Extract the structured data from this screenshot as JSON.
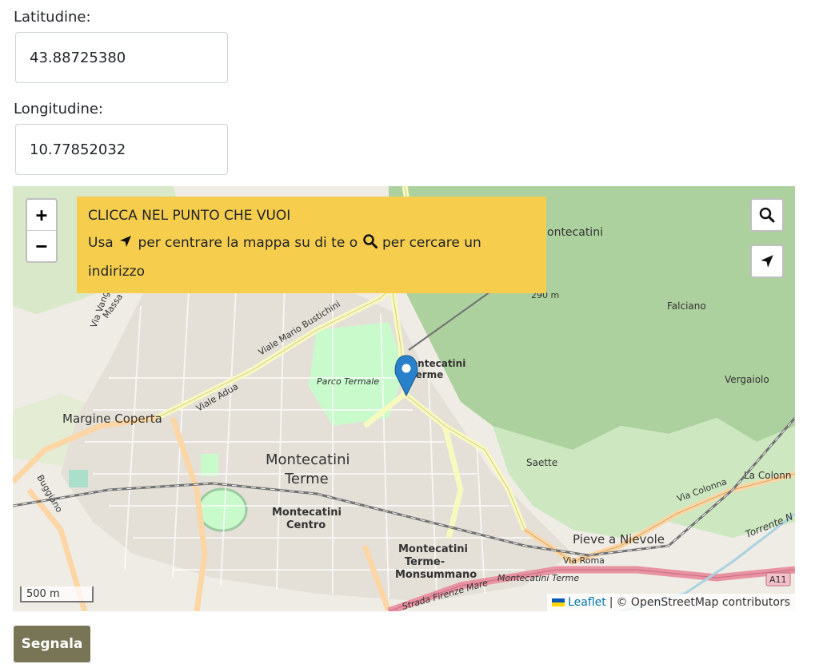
{
  "form": {
    "latitude_label": "Latitudine:",
    "latitude_value": "43.88725380",
    "longitude_label": "Longitudine:",
    "longitude_value": "10.77852032",
    "submit_label": "Segnala"
  },
  "map": {
    "zoom_in": "+",
    "zoom_out": "−",
    "instructions": {
      "title": "CLICCA NEL PUNTO CHE VUOI",
      "text_use": "Usa",
      "text_center": "per centrare la mappa su di te o",
      "text_search": "per cercare un indirizzo"
    },
    "scale_label": "500 m",
    "attribution": {
      "leaflet": "Leaflet",
      "separator": "|",
      "osm": "© OpenStreetMap contributors"
    },
    "places": {
      "montecatini_terme": "Montecatini",
      "montecatini_terme_2": "Terme",
      "margine_coperta": "Margine Coperta",
      "parco_termale": "Parco Termale",
      "montecatini_centro": "Montecatini",
      "montecatini_centro_2": "Centro",
      "station_monsummano": "Montecatini",
      "station_monsummano_2": "Terme-",
      "station_monsummano_3": "Monsummano",
      "station_top": "Montecatini",
      "station_top_2": "Terme",
      "pieve_a_nievole": "Pieve a Nievole",
      "falciano": "Falciano",
      "vergaiolo": "Vergaiolo",
      "saette": "Saette",
      "la_colonna": "La Colonn",
      "montecatini_alto": "ontecatini",
      "altitude": "290 m",
      "viale_adua": "Viale Adua",
      "viale_bustichini": "Viale Mario Bustichini",
      "via_colonna": "Via Colonna",
      "via_roma": "Via Roma",
      "strada_firenze_mare": "Strada Firenze Mare",
      "montecatini_terme_hwy": "Montecatini Terme",
      "a11": "A11",
      "torrente": "Torrente N",
      "massa": "Massa e C",
      "via_vangile": "Via Vangile",
      "borgo": "Buggiano"
    },
    "colors": {
      "land": "#f2efe9",
      "forest": "#add19e",
      "park": "#c8facc",
      "road_yellow": "#f7fabf",
      "road_orange": "#fcd6a4",
      "motorway": "#e892a2",
      "marker": "#2a81cb",
      "instructions_bg": "#f6cd4c"
    }
  }
}
